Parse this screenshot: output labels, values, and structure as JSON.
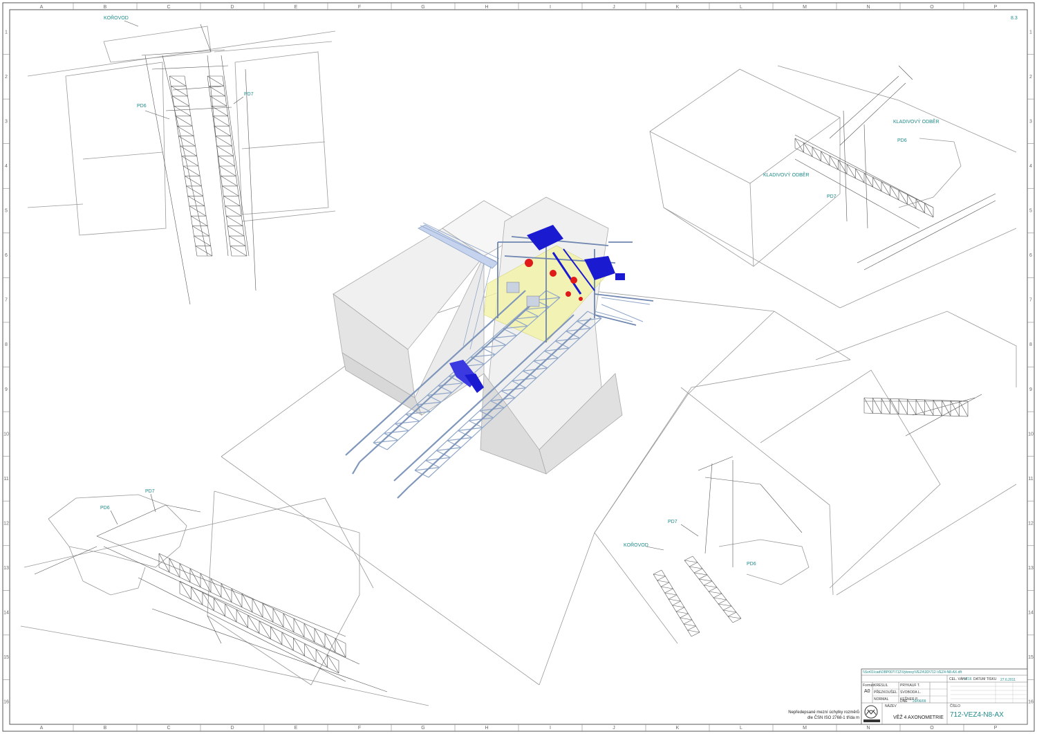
{
  "grid": {
    "columns": [
      "A",
      "B",
      "C",
      "D",
      "E",
      "F",
      "G",
      "H",
      "I",
      "J",
      "K",
      "L",
      "M",
      "N",
      "O",
      "P"
    ],
    "rows": [
      "1",
      "2",
      "3",
      "4",
      "5",
      "6",
      "7",
      "8",
      "9",
      "10",
      "11",
      "12",
      "13",
      "14",
      "15",
      "16"
    ]
  },
  "sheet_mark": "8.3",
  "labels": {
    "top_left": {
      "korovod": "KOŘOVOD",
      "pd6": "PD6",
      "pd7": "PD7"
    },
    "top_right": {
      "kladivovy_1": "KLADIVOVÝ ODBĚR",
      "kladivovy_2": "KLADIVOVÝ ODBĚR",
      "pd6": "PD6",
      "pd7": "PD7"
    },
    "bottom_left": {
      "pd6": "PD6",
      "pd7": "PD7"
    },
    "bottom_right": {
      "pd7": "PD7",
      "korovod": "KOŘOVOD",
      "pd6": "PD6"
    }
  },
  "title_block": {
    "path": "\\\\Svr01\\cad\\OBP007\\712\\Vykresy\\VEZ4\\3D\\712-VEZ4-N8-AX.dft",
    "cel_vaha_label": "CEL. VÁHA",
    "cel_vaha_value": "7.716",
    "datum_tisku_label": "DATUM TISKU",
    "datum_tisku_value": "27.6.2011",
    "format_label": "Formát",
    "format_value": "A0",
    "kreslil_label": "KRESLIL",
    "kreslil_value": "PRYKAUF T.",
    "prezkousel_label": "PŘEZKOUŠEL",
    "prezkousel_value": "SVOBODA L.",
    "normal_label": "NORMAL",
    "normal_value": "KEŠNER P.",
    "dne_label": "DNE",
    "dne_value": "29/06/09",
    "nazev_label": "NÁZEV",
    "nazev_value": "VĚŽ 4 AXONOMETRIE",
    "cislo_label": "ČÍSLO",
    "cislo_value": "712-VEZ4-N8-AX"
  },
  "tolerance_note": {
    "line1": "Nepředepsané mezní úchylky rozměrů",
    "line2": "dle ČSN ISO 2768-1  třída m"
  },
  "colors": {
    "steel": "#8fa6c8",
    "blue": "#1a1ad1",
    "red": "#e01919",
    "highlight": "#f3f3a6",
    "label": "#1f8a8a"
  }
}
